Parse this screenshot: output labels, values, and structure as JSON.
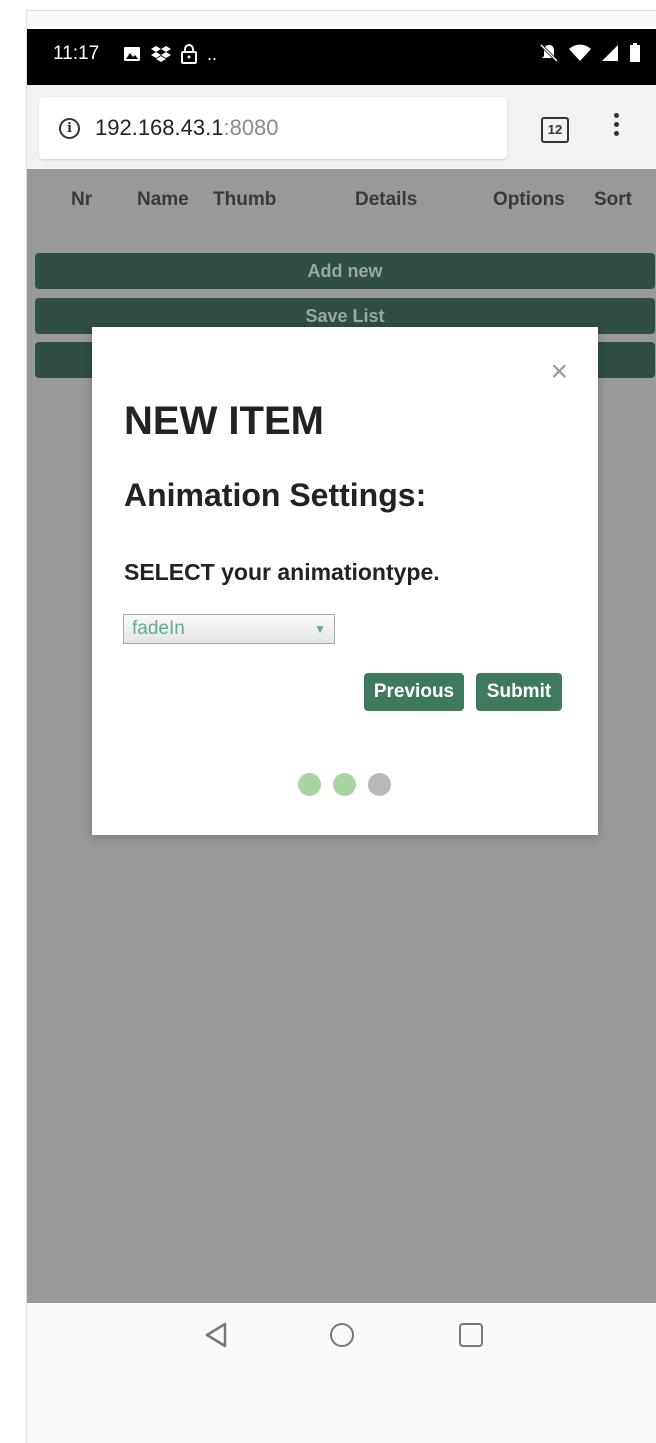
{
  "status_bar": {
    "time": "11:17",
    "left_icons": [
      "image-icon",
      "dropbox-icon",
      "lock-icon",
      "more-notifications-icon"
    ],
    "right_icons": [
      "notifications-off-icon",
      "wifi-icon",
      "signal-icon",
      "battery-icon"
    ],
    "more_text": ".."
  },
  "browser": {
    "url_host": "192.168.43.1",
    "url_port": ":8080",
    "tab_count": "12"
  },
  "table_header": {
    "columns": [
      "Nr",
      "Name",
      "Thumb",
      "Details",
      "Options",
      "Sort"
    ]
  },
  "list_buttons": {
    "add_new": "Add new",
    "save_list": "Save List",
    "third": ""
  },
  "modal": {
    "title": "NEW ITEM",
    "subtitle": "Animation Settings:",
    "instruction": "SELECT your animationtype.",
    "select_value": "fadeIn",
    "previous_label": "Previous",
    "submit_label": "Submit",
    "close_glyph": "×",
    "steps_total": 3,
    "steps_completed": 2
  },
  "colors": {
    "accent": "#3f7a5e",
    "list_button_bg": "#2e4f42",
    "overlay": "#999999",
    "dot_done": "#a8d5a2",
    "dot_pending": "#b8b8b8"
  }
}
